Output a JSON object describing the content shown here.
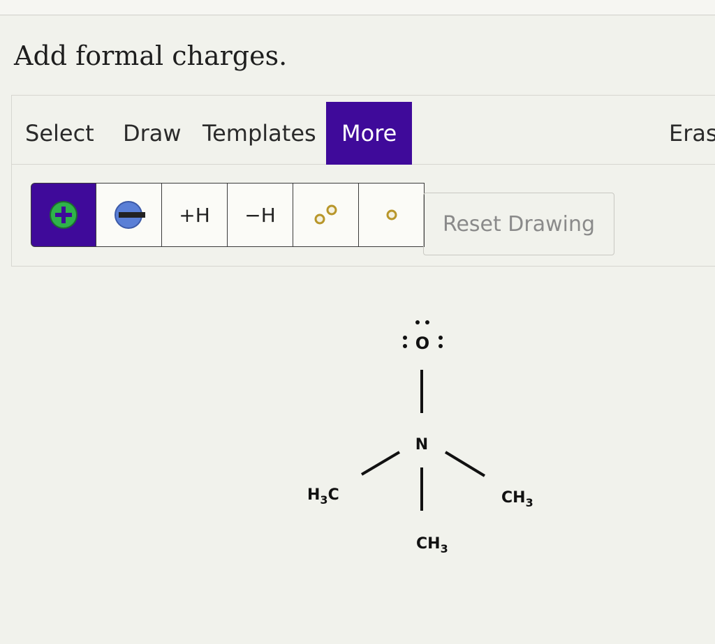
{
  "prompt": "Add formal charges.",
  "tabs": {
    "select": "Select",
    "draw": "Draw",
    "templates": "Templates",
    "more": "More",
    "erase": "Eras"
  },
  "toolbar": {
    "plus_h": "+H",
    "minus_h": "−H",
    "reset_label": "Reset Drawing"
  },
  "molecule": {
    "oxygen": "O",
    "nitrogen": "N",
    "left_methyl": {
      "main": "H",
      "sub": "3",
      "tail": "C"
    },
    "right_methyl": {
      "main": "CH",
      "sub": "3"
    },
    "bottom_methyl": {
      "main": "CH",
      "sub": "3"
    }
  },
  "colors": {
    "accent": "#3f0a9a",
    "plus_charge": "#2fb34a",
    "minus_charge": "#5a7fd6",
    "electron_dot": "#b8962a"
  },
  "icons": [
    "plus-charge-icon",
    "minus-charge-icon",
    "lone-pair-icon",
    "radical-icon"
  ]
}
